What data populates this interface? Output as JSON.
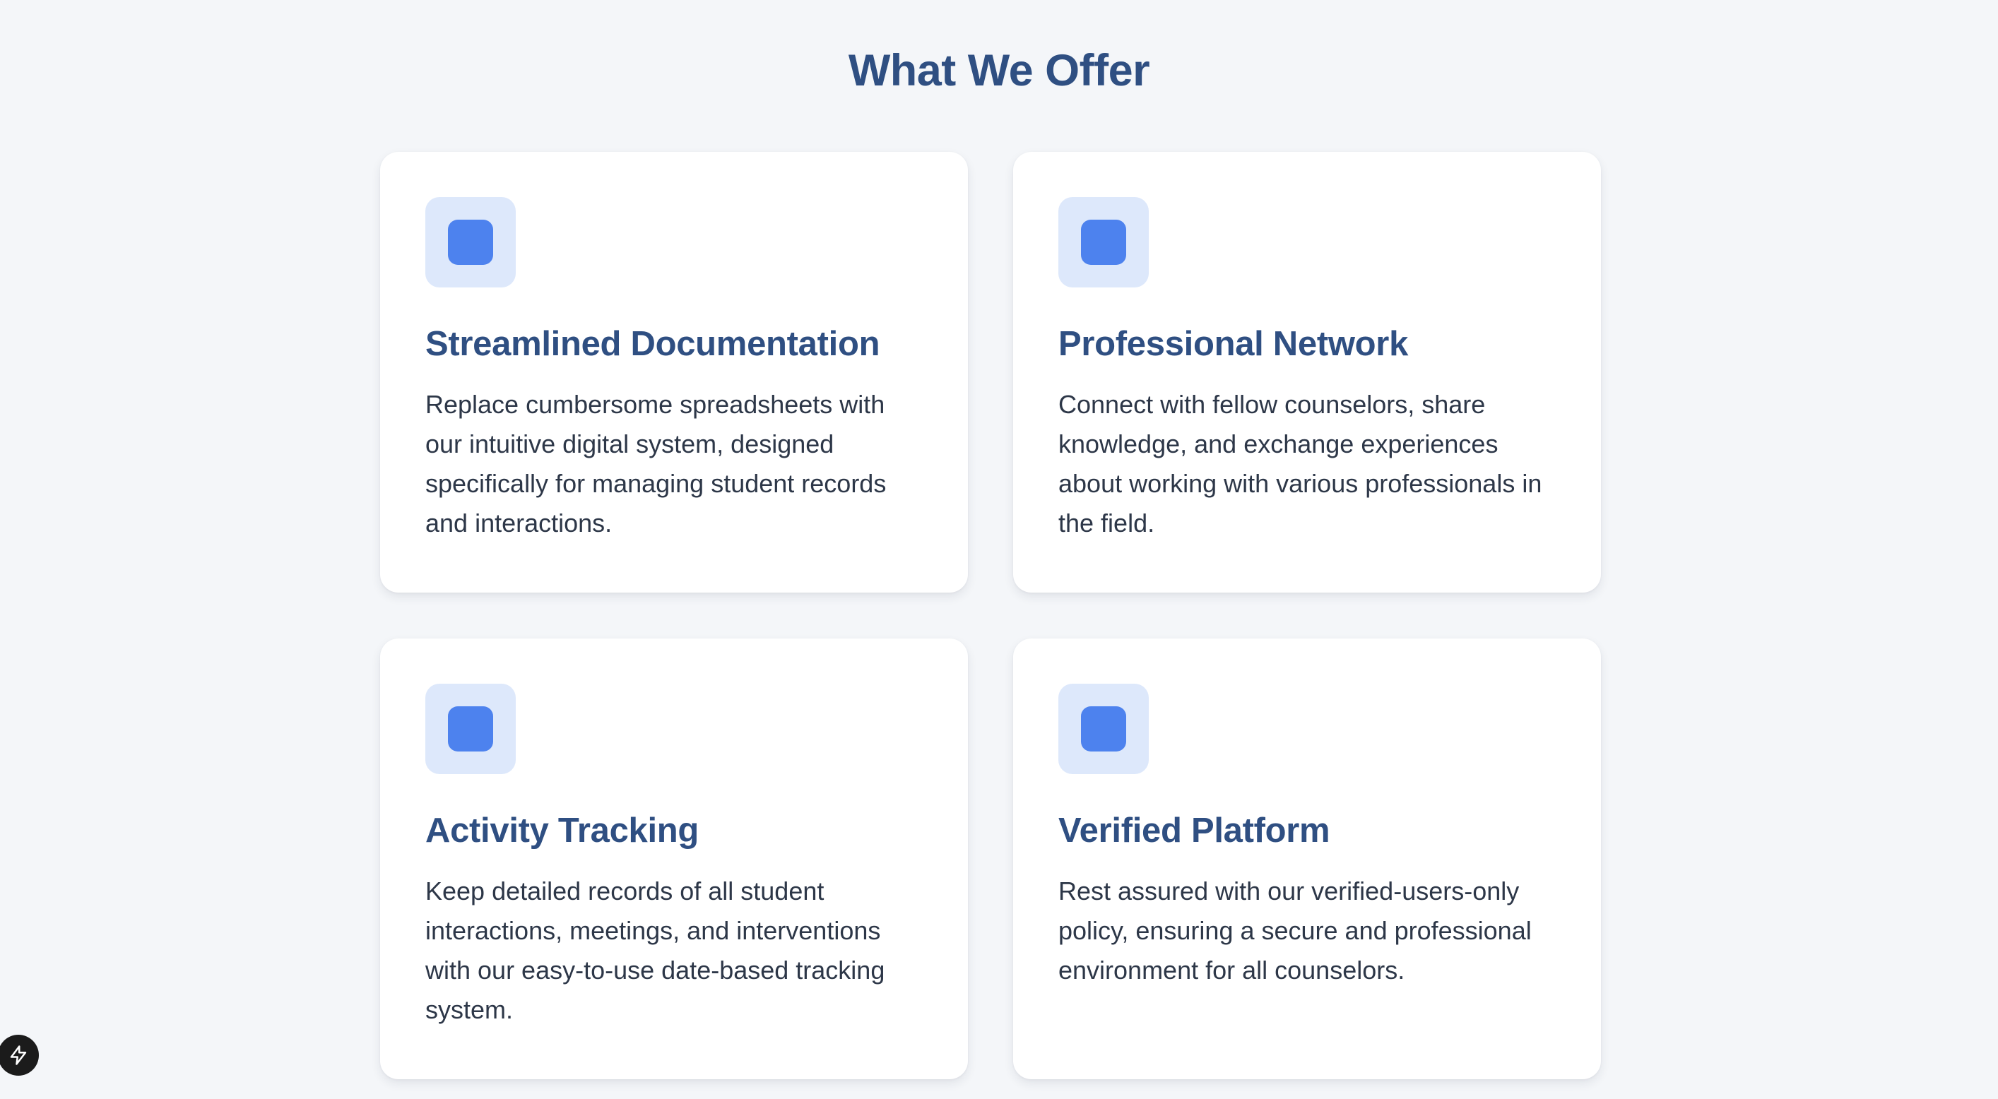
{
  "section": {
    "title": "What We Offer"
  },
  "features": [
    {
      "icon": "feature-square-icon",
      "title": "Streamlined Documentation",
      "description": "Replace cumbersome spreadsheets with our intuitive digital system, designed specifically for managing student records and interactions."
    },
    {
      "icon": "feature-square-icon",
      "title": "Professional Network",
      "description": "Connect with fellow counselors, share knowledge, and exchange experiences about working with various professionals in the field."
    },
    {
      "icon": "feature-square-icon",
      "title": "Activity Tracking",
      "description": "Keep detailed records of all student interactions, meetings, and interventions with our easy-to-use date-based tracking system."
    },
    {
      "icon": "feature-square-icon",
      "title": "Verified Platform",
      "description": "Rest assured with our verified-users-only policy, ensuring a secure and professional environment for all counselors."
    }
  ],
  "badge": {
    "icon": "lightning-bolt-icon"
  },
  "colors": {
    "background": "#f4f6f9",
    "card": "#ffffff",
    "heading": "#2f4f82",
    "body_text": "#2d3748",
    "icon_tile": "#dde8fb",
    "icon_fill": "#4d82ee"
  }
}
